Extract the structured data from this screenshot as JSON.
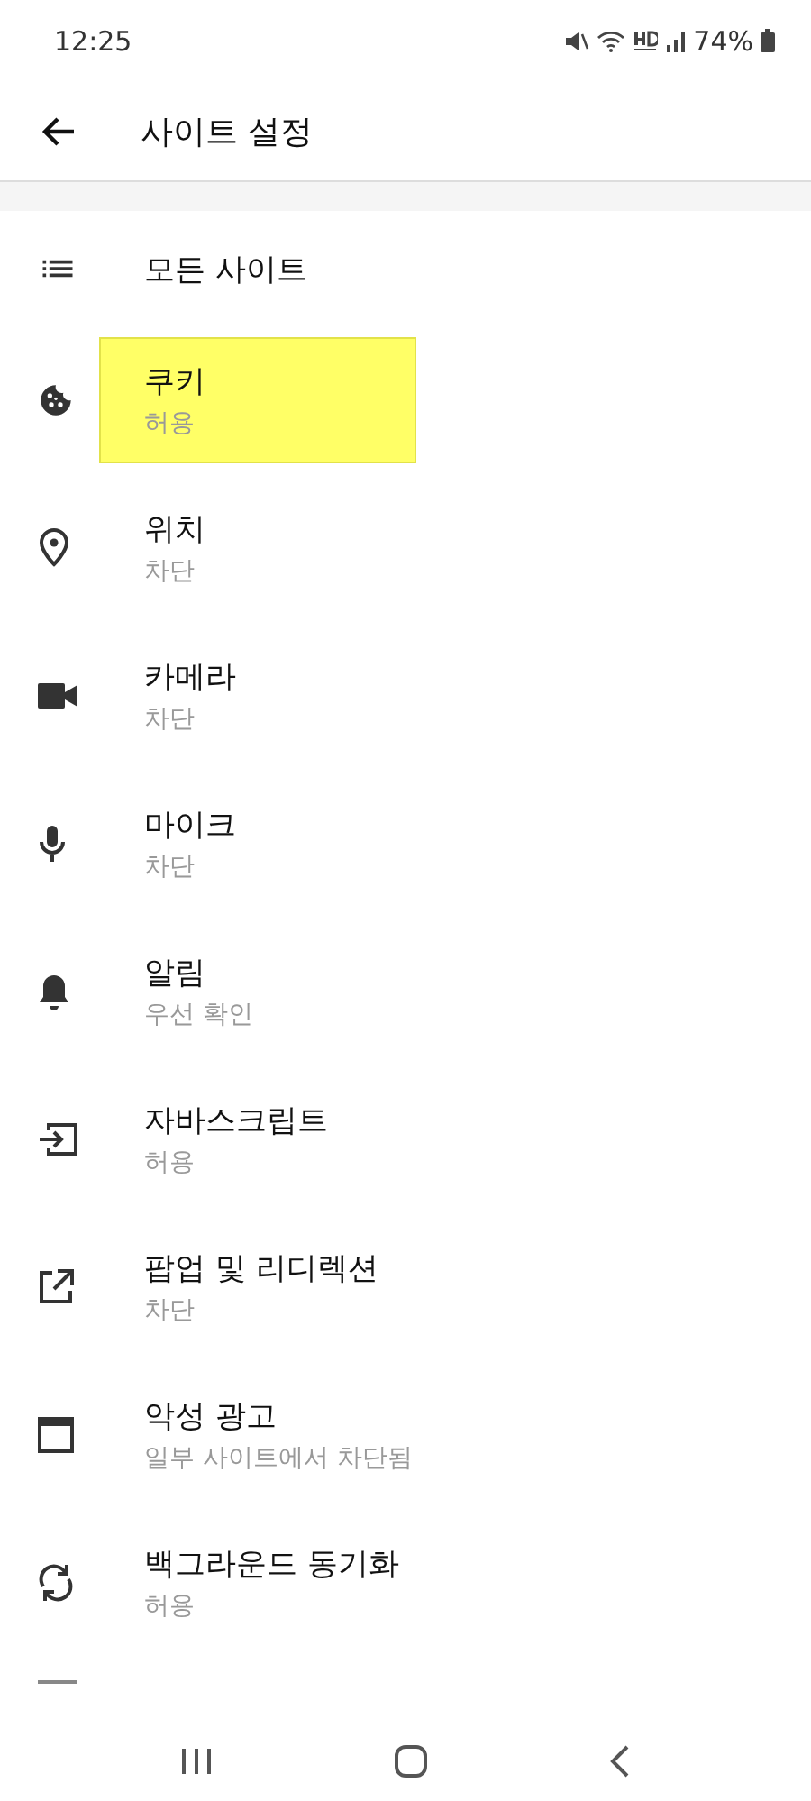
{
  "status_bar": {
    "time": "12:25",
    "battery": "74%"
  },
  "app_bar": {
    "title": "사이트 설정"
  },
  "all_sites": {
    "label": "모든 사이트"
  },
  "settings": [
    {
      "kind": "cookie",
      "title": "쿠키",
      "status": "허용",
      "highlighted": true
    },
    {
      "kind": "location",
      "title": "위치",
      "status": "차단",
      "highlighted": false
    },
    {
      "kind": "camera",
      "title": "카메라",
      "status": "차단",
      "highlighted": false
    },
    {
      "kind": "mic",
      "title": "마이크",
      "status": "차단",
      "highlighted": false
    },
    {
      "kind": "bell",
      "title": "알림",
      "status": "우선 확인",
      "highlighted": false
    },
    {
      "kind": "javascript",
      "title": "자바스크립트",
      "status": "허용",
      "highlighted": false
    },
    {
      "kind": "popup",
      "title": "팝업 및 리디렉션",
      "status": "차단",
      "highlighted": false
    },
    {
      "kind": "ads",
      "title": "악성 광고",
      "status": "일부 사이트에서 차단됨",
      "highlighted": false
    },
    {
      "kind": "sync",
      "title": "백그라운드 동기화",
      "status": "허용",
      "highlighted": false
    }
  ],
  "partial_item": {
    "kind": "protected"
  }
}
